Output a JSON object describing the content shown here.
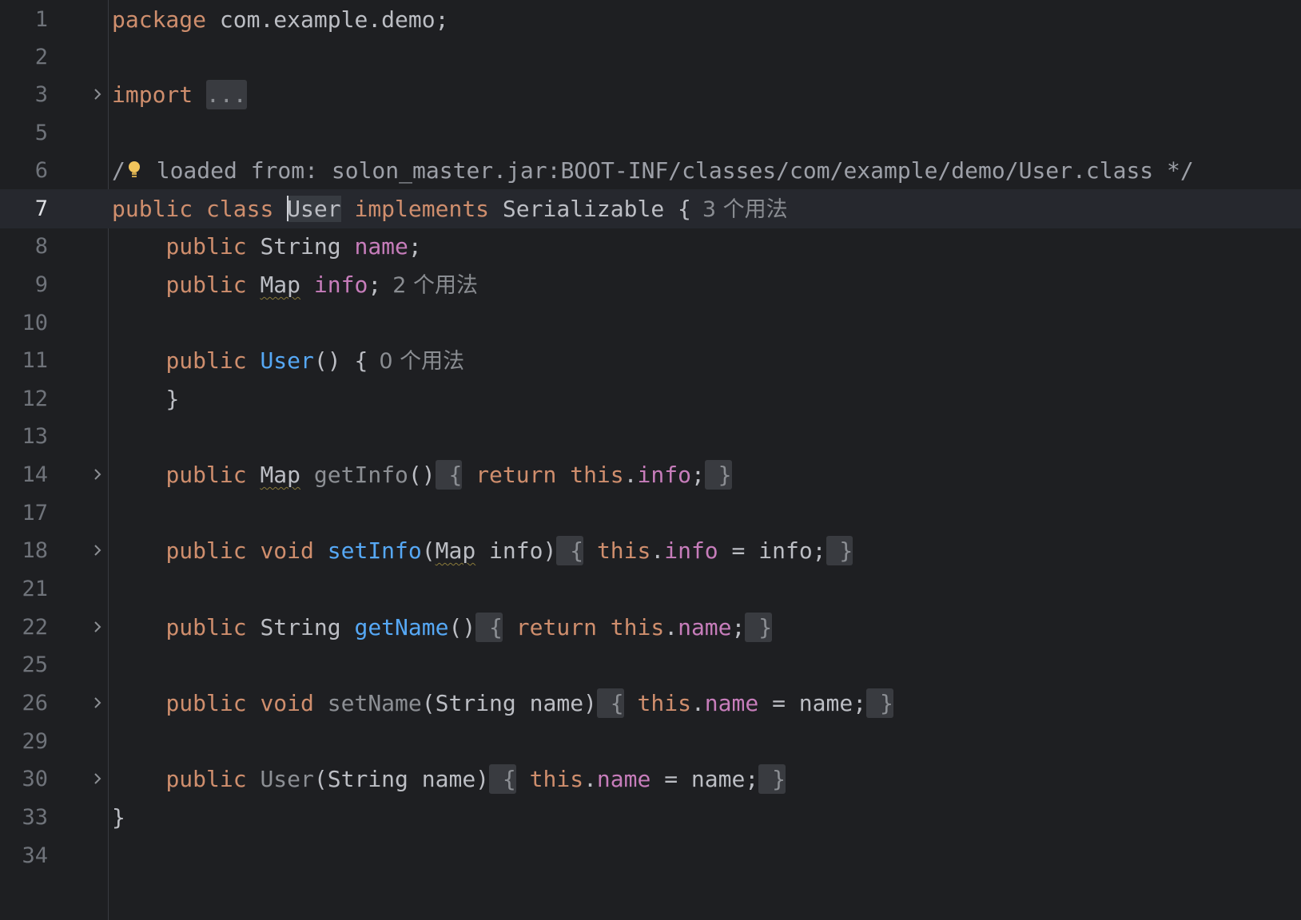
{
  "editor": {
    "line_numbers": [
      "1",
      "2",
      "3",
      "5",
      "6",
      "7",
      "8",
      "9",
      "10",
      "11",
      "12",
      "13",
      "14",
      "17",
      "18",
      "21",
      "22",
      "25",
      "26",
      "29",
      "30",
      "33",
      "34"
    ],
    "current_line": "7",
    "colors": {
      "background": "#1e1f22",
      "keyword": "#cf8e6d",
      "field": "#c77dbb",
      "function": "#56a8f5",
      "text": "#bcbec4"
    }
  },
  "code": {
    "l1": {
      "kw": "package",
      "rest": " com.example.demo;"
    },
    "l3": {
      "kw": "import",
      "folded": "..."
    },
    "l6": {
      "slash": "/",
      "comment": " loaded from: solon_master.jar:BOOT-INF/classes/com/example/demo/User.class */"
    },
    "l7": {
      "kw1": "public",
      "kw2": "class",
      "name": "User",
      "kw3": "implements",
      "iface": "Serializable {",
      "hint": "3 个用法"
    },
    "l8": {
      "kw": "public",
      "type": "String",
      "field": "name",
      "end": ";"
    },
    "l9": {
      "kw": "public",
      "type": "Map",
      "field": "info",
      "end": ";",
      "hint": "2 个用法"
    },
    "l11": {
      "kw": "public",
      "fn": "User",
      "rest": "() {",
      "hint": "0 个用法"
    },
    "l12": {
      "rest": "}"
    },
    "l14": {
      "kw": "public",
      "type": "Map",
      "fn": "getInfo",
      "params": "()",
      "open": " {",
      "kw_ret": "return",
      "kw_this": "this",
      "dot": ".",
      "field": "info",
      "semi": ";",
      "close": " }"
    },
    "l18": {
      "kw": "public",
      "kw2": "void",
      "fn": "setInfo",
      "p_open": "(",
      "p_type": "Map",
      "p_rest": " info)",
      "open": " {",
      "kw_this": "this",
      "dot": ".",
      "field": "info",
      "assign": " = info;",
      "close": " }"
    },
    "l22": {
      "kw": "public",
      "type": "String",
      "fn": "getName",
      "params": "()",
      "open": " {",
      "kw_ret": "return",
      "kw_this": "this",
      "dot": ".",
      "field": "name",
      "semi": ";",
      "close": " }"
    },
    "l26": {
      "kw": "public",
      "kw2": "void",
      "fn": "setName",
      "params": "(String name)",
      "open": " {",
      "kw_this": "this",
      "dot": ".",
      "field": "name",
      "assign": " = name;",
      "close": " }"
    },
    "l30": {
      "kw": "public",
      "fn": "User",
      "params": "(String name)",
      "open": " {",
      "kw_this": "this",
      "dot": ".",
      "field": "name",
      "assign": " = name;",
      "close": " }"
    },
    "l33": {
      "rest": "}"
    }
  }
}
